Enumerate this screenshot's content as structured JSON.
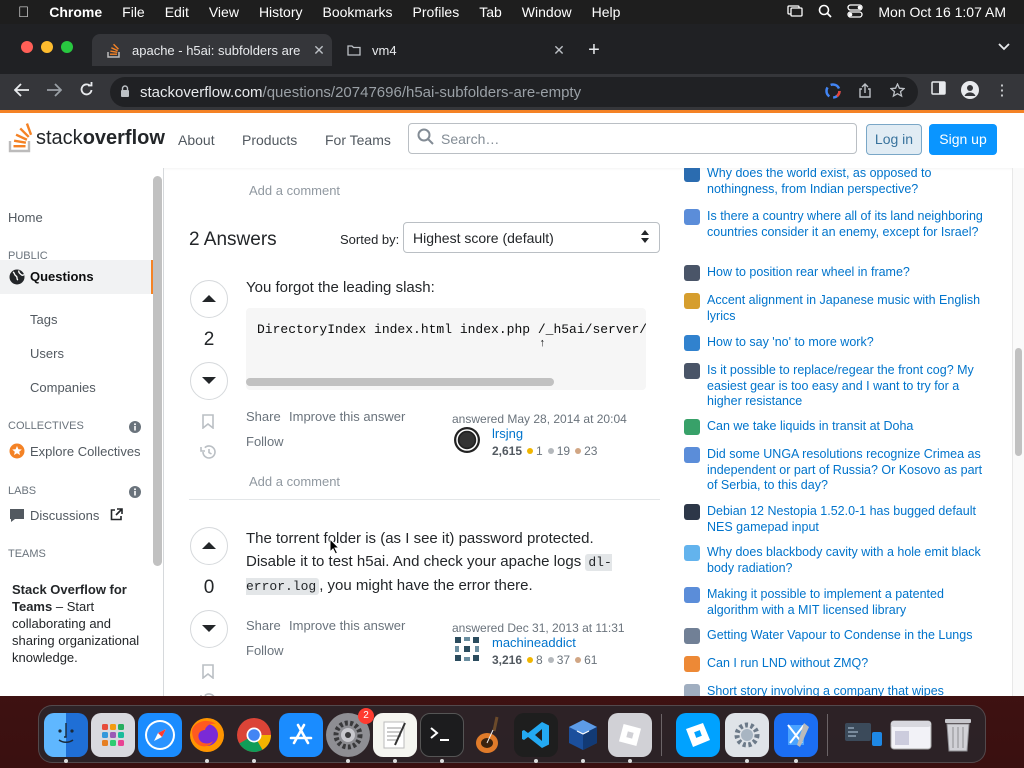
{
  "menubar": {
    "app": "Chrome",
    "items": [
      "File",
      "Edit",
      "View",
      "History",
      "Bookmarks",
      "Profiles",
      "Tab",
      "Window",
      "Help"
    ],
    "clock": "Mon Oct 16  1:07 AM"
  },
  "browser": {
    "tabs": [
      {
        "title": "apache - h5ai: subfolders are"
      },
      {
        "title": "vm4"
      }
    ],
    "url_host": "stackoverflow.com",
    "url_path": "/questions/20747696/h5ai-subfolders-are-empty"
  },
  "so": {
    "logo_text_1": "stack",
    "logo_text_2": "overflow",
    "nav": [
      "About",
      "Products",
      "For Teams"
    ],
    "search_placeholder": "Search…",
    "login": "Log in",
    "signup": "Sign up"
  },
  "leftnav": {
    "home": "Home",
    "public": "PUBLIC",
    "questions": "Questions",
    "tags": "Tags",
    "users": "Users",
    "companies": "Companies",
    "collectives": "COLLECTIVES",
    "explore_collectives": "Explore Collectives",
    "labs": "LABS",
    "discussions": "Discussions",
    "teams": "TEAMS",
    "teams_box_title": "Stack Overflow for Teams",
    "teams_box_text": " – Start collaborating and sharing organizational knowledge."
  },
  "main": {
    "add_comment_top": "Add a comment",
    "answers_header": "2 Answers",
    "sorted_by": "Sorted by:",
    "sort_selected": "Highest score (default)",
    "answers": [
      {
        "score": "2",
        "text": "You forgot the leading slash:",
        "code_line_1": "DirectoryIndex index.html index.php /_h5ai/server/",
        "code_line_2": "↑",
        "share": "Share",
        "improve": "Improve this answer",
        "follow": "Follow",
        "answered": "answered May 28, 2014 at 20:04",
        "user": "lrsjng",
        "rep": "2,615",
        "gold": "1",
        "silver": "19",
        "bronze": "23",
        "add_comment": "Add a comment"
      },
      {
        "score": "0",
        "text_1": "The torrent folder is (as I see it) password protected. Disable it to test h5ai. And check your apache logs ",
        "code": "dl-error.log",
        "text_2": ", you might have the error there.",
        "share": "Share",
        "improve": "Improve this answer",
        "follow": "Follow",
        "answered": "answered Dec 31, 2013 at 11:31",
        "user": "machineaddict",
        "rep": "3,216",
        "gold": "8",
        "silver": "37",
        "bronze": "61"
      }
    ]
  },
  "hot_questions": [
    {
      "text": "Why does the world exist, as opposed to nothingness, from Indian perspective?",
      "color": "#2b6cb0"
    },
    {
      "text": "Is there a country where all of its land neighboring countries consider it an enemy, except for Israel?",
      "color": "#5b8dd9"
    },
    {
      "text": "How to position rear wheel in frame?",
      "color": "#4a5568"
    },
    {
      "text": "Accent alignment in Japanese music with English lyrics",
      "color": "#d69e2e"
    },
    {
      "text": "How to say 'no' to more work?",
      "color": "#3182ce"
    },
    {
      "text": "Is it possible to replace/regear the front cog? My easiest gear is too easy and I want to try for a higher resistance",
      "color": "#4a5568"
    },
    {
      "text": "Can we take liquids in transit at Doha",
      "color": "#38a169"
    },
    {
      "text": "Did some UNGA resolutions recognize Crimea as independent or part of Russia? Or Kosovo as part of Serbia, to this day?",
      "color": "#5b8dd9"
    },
    {
      "text": "Debian 12 Nestopia 1.52.0-1 has bugged default NES gamepad input",
      "color": "#2d3748"
    },
    {
      "text": "Why does blackbody cavity with a hole emit black body radiation?",
      "color": "#63b3ed"
    },
    {
      "text": "Making it possible to implement a patented algorithm with a MIT licensed library",
      "color": "#5b8dd9"
    },
    {
      "text": "Getting Water Vapour to Condense in the Lungs",
      "color": "#718096"
    },
    {
      "text": "Can I run LND without ZMQ?",
      "color": "#ed8936"
    },
    {
      "text": "Short story involving a company that wipes workers' memories at the end of every workday",
      "color": "#a0aec0"
    }
  ],
  "dock_badge": "2"
}
